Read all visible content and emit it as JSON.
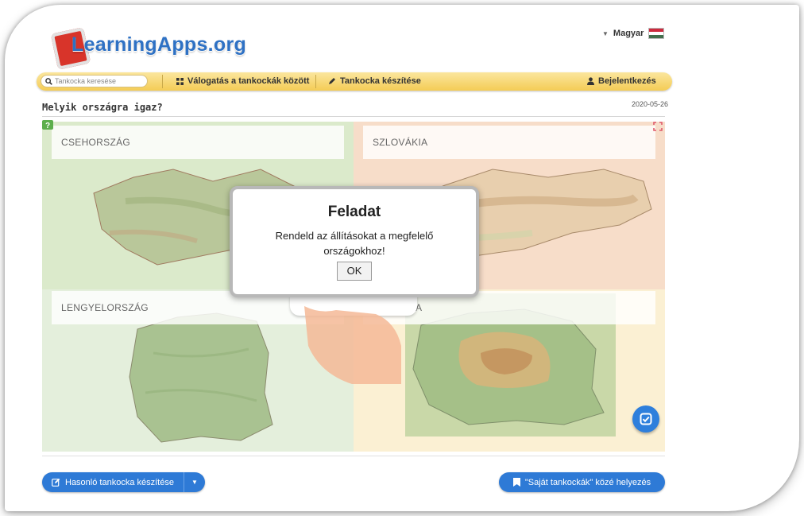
{
  "header": {
    "logo_text": "LearningApps.org",
    "language": "Magyar"
  },
  "nav": {
    "search_placeholder": "Tankocka keresése",
    "browse": "Válogatás a tankockák között",
    "create": "Tankocka készítése",
    "login": "Bejelentkezés"
  },
  "app": {
    "title": "Melyik országra igaz?",
    "date": "2020-05-26",
    "quadrants": {
      "czech": "CSEHORSZÁG",
      "slovakia": "SZLOVÁKIA",
      "poland": "LENGYELORSZÁG",
      "romania_partial": "A"
    }
  },
  "dialog": {
    "title": "Feladat",
    "message": "Rendeld az állításokat a megfelelő országokhoz!",
    "ok": "OK"
  },
  "footer": {
    "similar_button": "Hasonló tankocka készítése",
    "save_button": "\"Saját tankockák\" közé helyezés"
  },
  "colors": {
    "accent_blue": "#2e7ad6",
    "nav_yellow": "#f4cc55",
    "dialog_border": "#b8b8b8"
  },
  "icons": [
    "search-icon",
    "grid-icon",
    "pencil-icon",
    "user-icon",
    "help-icon",
    "fullscreen-icon",
    "check-icon",
    "edit-icon",
    "caret-down-icon",
    "bookmark-icon"
  ]
}
